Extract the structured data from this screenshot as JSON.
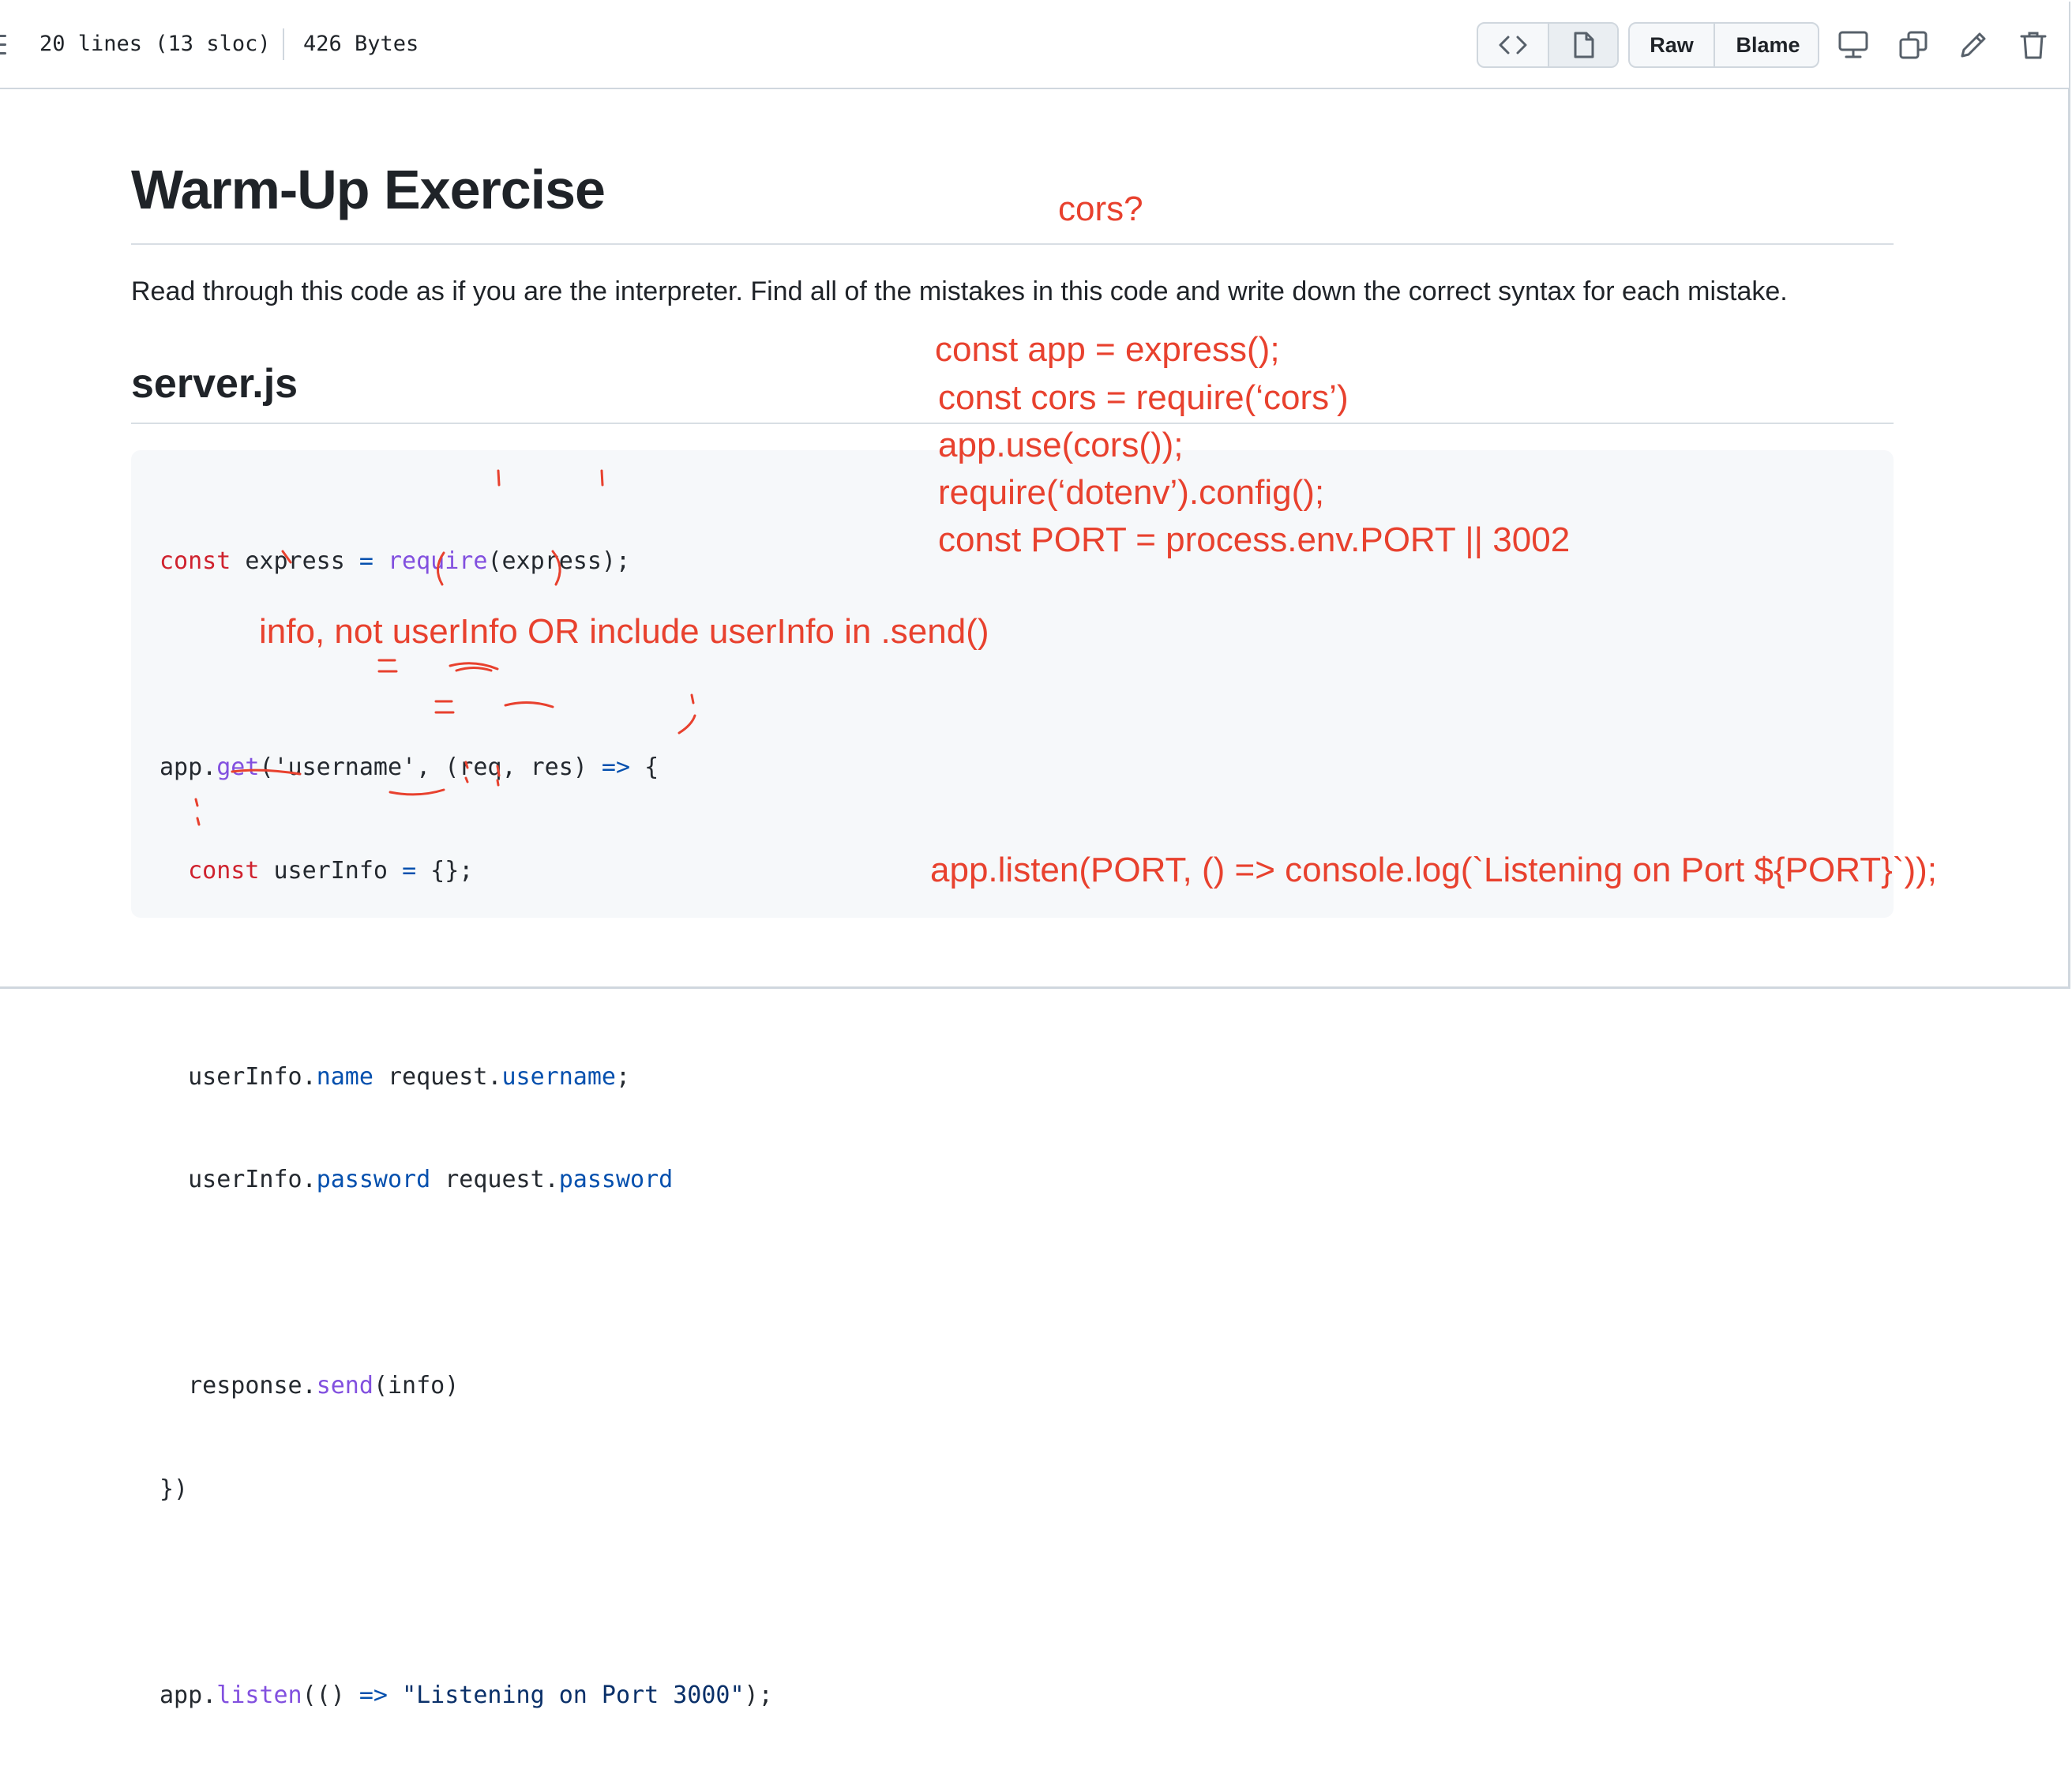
{
  "file_header": {
    "lines_info": "20 lines (13 sloc)",
    "size_info": "426 Bytes",
    "raw_label": "Raw",
    "blame_label": "Blame",
    "icons": [
      "menu-icon",
      "code-icon",
      "file-icon",
      "desktop-icon",
      "copy-icon",
      "pencil-icon",
      "trash-icon"
    ]
  },
  "doc": {
    "title": "Warm-Up Exercise",
    "description": "Read through this code as if you are the interpreter. Find all of the mistakes in this code and write down the correct syntax for each mistake.",
    "subtitle": "server.js"
  },
  "code": {
    "line1": [
      "const",
      " express ",
      "=",
      " ",
      "require",
      "(express);"
    ],
    "line3": [
      "app.",
      "get",
      "('username', (req, res) ",
      "=>",
      " {"
    ],
    "line4": [
      "  ",
      "const",
      " userInfo ",
      "=",
      " {};"
    ],
    "line6": [
      "  userInfo.",
      "name",
      " request.",
      "username",
      ";"
    ],
    "line7": [
      "  userInfo.",
      "password",
      " request.",
      "password"
    ],
    "line9": [
      "  response.",
      "send",
      "(info)"
    ],
    "line10": "})",
    "line12": [
      "app.",
      "listen",
      "(() ",
      "=>",
      " ",
      "\"Listening on Port 3000\"",
      ");"
    ]
  },
  "annotations": {
    "cors_q": "cors?",
    "fix1": "const app = express();",
    "fix2": "const cors = require(‘cors’)",
    "fix3": "app.use(cors());",
    "fix4": "require(‘dotenv’).config();",
    "fix5": "const PORT = process.env.PORT || 3002",
    "info_note": "info, not userInfo OR include userInfo in .send()",
    "listen_fix": "app.listen(PORT, () => console.log(`Listening on Port ${PORT}`));"
  },
  "colors": {
    "annotation": "#e8412e",
    "keyword": "#cf222e",
    "function": "#8250df",
    "operator": "#0550ae",
    "string": "#0a3069"
  }
}
